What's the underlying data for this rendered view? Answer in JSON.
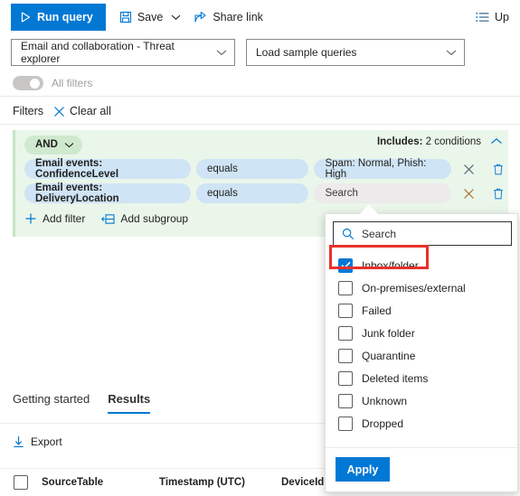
{
  "commandbar": {
    "run_query": "Run query",
    "run_query_icon": "play-triangle-icon",
    "save": "Save",
    "save_icon": "save-disk-icon",
    "save_chevron_icon": "chevron-down-icon",
    "share_link": "Share link",
    "share_icon": "share-arrow-icon",
    "upsell_label": "Up",
    "upsell_icon": "bulleted-list-icon"
  },
  "selectors": {
    "scope": {
      "value": "Email and collaboration - Threat explorer",
      "chevron_icon": "chevron-down-icon"
    },
    "samples": {
      "value": "Load sample queries",
      "chevron_icon": "chevron-down-icon"
    }
  },
  "all_filters": {
    "label": "All filters",
    "enabled": false
  },
  "filters": {
    "label": "Filters",
    "clear_all": "Clear all",
    "clear_all_icon": "close-x-icon"
  },
  "group": {
    "operator": "AND",
    "operator_chevron_icon": "chevron-down-icon",
    "includes_prefix": "Includes:",
    "includes_value": "2 conditions",
    "collapse_icon": "chevron-up-icon",
    "conditions": [
      {
        "field": "Email events: ConfidenceLevel",
        "operator": "equals",
        "value": "Spam: Normal, Phish: High",
        "active": false,
        "clear_icon": "close-x-icon",
        "delete_icon": "trash-icon"
      },
      {
        "field": "Email events: DeliveryLocation",
        "operator": "equals",
        "value": "Search",
        "active": true,
        "clear_icon": "close-x-icon",
        "delete_icon": "trash-icon"
      }
    ],
    "add_filter": "Add filter",
    "add_filter_icon": "plus-icon",
    "add_subgroup": "Add subgroup",
    "add_subgroup_icon": "add-subgroup-icon"
  },
  "dropdown": {
    "search_placeholder": "Search",
    "search_icon": "search-magnifier-icon",
    "check_icon": "checkmark-icon",
    "options": [
      {
        "label": "Inbox/folder",
        "checked": true,
        "highlighted": true
      },
      {
        "label": "On-premises/external",
        "checked": false,
        "highlighted": false
      },
      {
        "label": "Failed",
        "checked": false,
        "highlighted": false
      },
      {
        "label": "Junk folder",
        "checked": false,
        "highlighted": false
      },
      {
        "label": "Quarantine",
        "checked": false,
        "highlighted": false
      },
      {
        "label": "Deleted items",
        "checked": false,
        "highlighted": false
      },
      {
        "label": "Unknown",
        "checked": false,
        "highlighted": false
      },
      {
        "label": "Dropped",
        "checked": false,
        "highlighted": false
      }
    ],
    "apply": "Apply"
  },
  "results": {
    "tabs": [
      {
        "label": "Getting started",
        "active": false
      },
      {
        "label": "Results",
        "active": true
      }
    ],
    "export": "Export",
    "export_icon": "download-arrow-icon",
    "columns": [
      "SourceTable",
      "Timestamp (UTC)",
      "DeviceId"
    ]
  },
  "colors": {
    "accent": "#0078d4",
    "group_bg": "#eaf6ea",
    "and_pill": "#cfe9cf",
    "pill_blue": "#cfe4f5",
    "highlight_red": "#e8312a"
  }
}
